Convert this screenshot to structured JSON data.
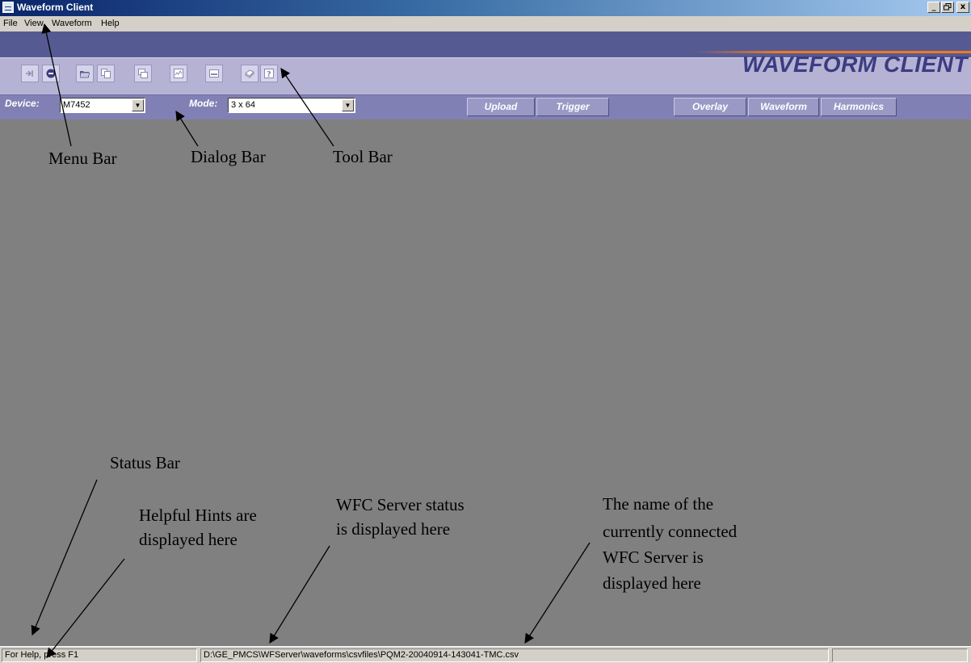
{
  "window": {
    "title": "Waveform Client",
    "caption_buttons": [
      "_",
      "▫",
      "x"
    ]
  },
  "menu": [
    "File",
    "View",
    "Waveform",
    "Help"
  ],
  "brand": "WAVEFORM CLIENT",
  "toolbar": {
    "buttons": [
      "upload-icon",
      "stop-icon",
      "open-folder-icon",
      "copy-icon",
      "window-icon",
      "chart-icon",
      "dialog-icon",
      "print-icon",
      "help-icon"
    ]
  },
  "dialog_bar": {
    "device_label": "Device:",
    "device_value": "M7452",
    "mode_label": "Mode:",
    "mode_value": "3 x 64",
    "upload": "Upload",
    "trigger": "Trigger",
    "overlay": "Overlay",
    "waveform": "Waveform",
    "harmonics": "Harmonics"
  },
  "status_bar": {
    "help_text": "For Help, press F1",
    "path": "D:\\GE_PMCS\\WFServer\\waveforms\\csvfiles\\PQM2-20040914-143041-TMC.csv",
    "server": ""
  },
  "annotations": {
    "menu_bar": "Menu Bar",
    "dialog_bar": "Dialog Bar",
    "tool_bar": "Tool Bar",
    "status_bar": "Status Bar",
    "hints_1": "Helpful Hints are",
    "hints_2": "displayed  here",
    "server_status_1": "WFC Server status",
    "server_status_2": "is displayed here",
    "server_name_1": "The name of the",
    "server_name_2": "currently connected",
    "server_name_3": "WFC Server is",
    "server_name_4": "displayed here"
  },
  "colors": {
    "title_gradient_start": "#0a246a",
    "toolbar_band": "#b5b2d4",
    "dialog_bar": "#8180b4",
    "brand_text": "#3b3c82",
    "brand_accent": "#f2781e",
    "client_area": "#808080"
  }
}
